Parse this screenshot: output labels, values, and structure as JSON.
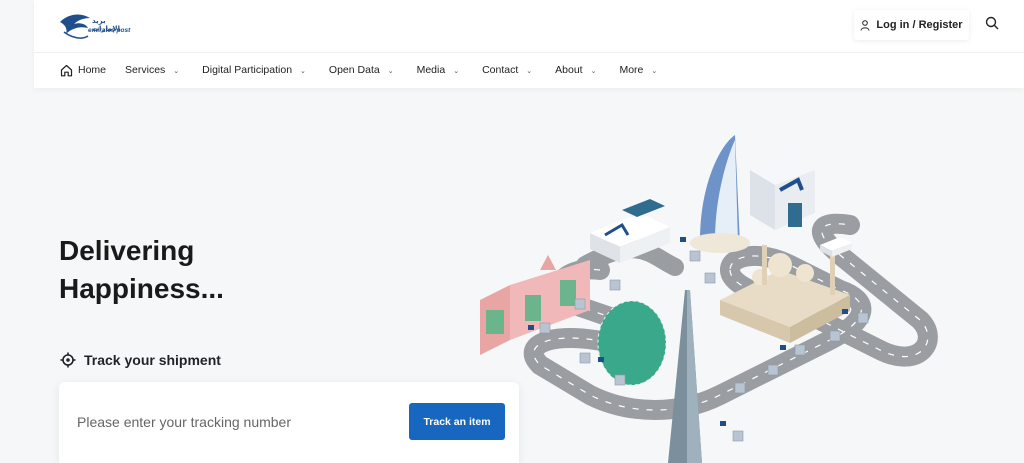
{
  "brand": {
    "name_ar": "بريد الإمارات",
    "name_en": "emirates post",
    "color": "#1f4e8c"
  },
  "header": {
    "login_label": "Log in / Register",
    "icons": [
      "user-icon",
      "search-icon"
    ]
  },
  "nav": {
    "items": [
      {
        "label": "Home",
        "icon": "home-icon"
      },
      {
        "label": "Services",
        "has_dropdown": true
      },
      {
        "label": "Digital Participation",
        "has_dropdown": true
      },
      {
        "label": "Open Data",
        "has_dropdown": true
      },
      {
        "label": "Media",
        "has_dropdown": true
      },
      {
        "label": "Contact",
        "has_dropdown": true
      },
      {
        "label": "About",
        "has_dropdown": true
      },
      {
        "label": "More",
        "has_dropdown": true
      }
    ]
  },
  "hero": {
    "title_line1": "Delivering",
    "title_line2": "Happiness...",
    "track_heading": "Track your shipment",
    "track_icon": "target-icon",
    "input_placeholder": "Please enter your tracking number",
    "input_value": "",
    "button_label": "Track an item"
  },
  "colors": {
    "accent": "#1767c1",
    "road": "#9a9ea3",
    "background": "#f6f7f8"
  }
}
